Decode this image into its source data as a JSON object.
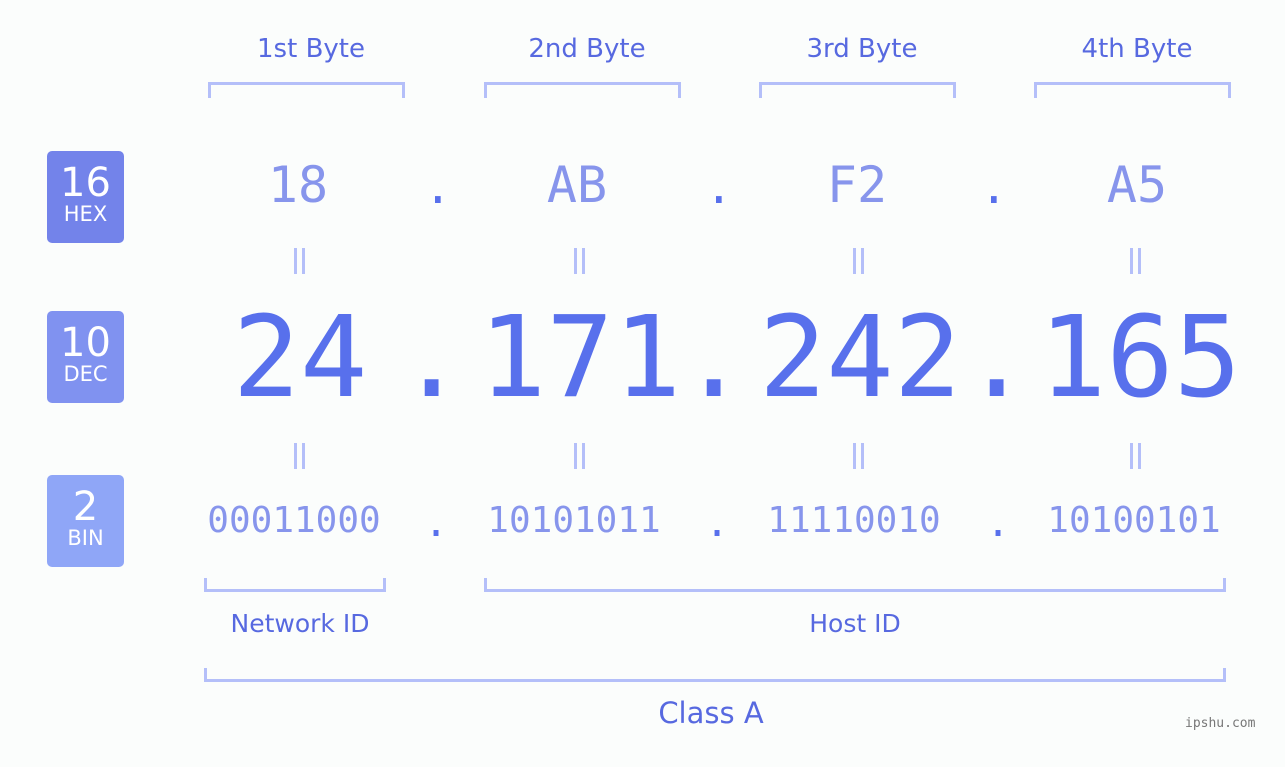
{
  "bases": [
    {
      "number": "16",
      "label": "HEX"
    },
    {
      "number": "10",
      "label": "DEC"
    },
    {
      "number": "2",
      "label": "BIN"
    }
  ],
  "byte_headers": [
    "1st Byte",
    "2nd Byte",
    "3rd Byte",
    "4th Byte"
  ],
  "hex": [
    "18",
    "AB",
    "F2",
    "A5"
  ],
  "dec": [
    "24",
    "171",
    "242",
    "165"
  ],
  "bin": [
    "00011000",
    "10101011",
    "11110010",
    "10100101"
  ],
  "separator": ".",
  "segments": {
    "network_id": "Network ID",
    "host_id": "Host ID",
    "class": "Class A"
  },
  "colors": {
    "primary": "#5870ec",
    "light": "#8795ec",
    "bracket": "#b4bff9"
  },
  "watermark": "ipshu.com"
}
